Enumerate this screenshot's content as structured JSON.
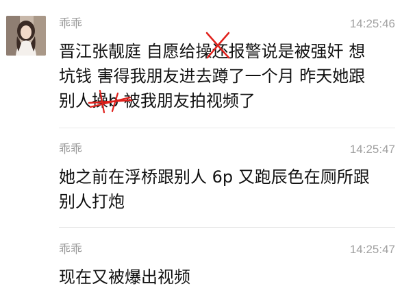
{
  "messages": [
    {
      "sender": "乖乖",
      "time": "14:25:46",
      "text": "晋江张靓庭 自愿给操还报警说是被强奸 想\n坑钱 害得我朋友进去蹲了一个月 昨天她跟\n别人操b 被我朋友拍视频了"
    },
    {
      "sender": "乖乖",
      "time": "14:25:47",
      "text": "她之前在浮桥跟别人 6p 又跑辰色在厕所跟\n别人打炮"
    },
    {
      "sender": "乖乖",
      "time": "14:25:47",
      "text": "现在又被爆出视频"
    }
  ],
  "colors": {
    "scribble": "#e0201b",
    "divider": "#e9e9e9",
    "meta_text": "#9a9a9a",
    "body_text": "#111111"
  }
}
